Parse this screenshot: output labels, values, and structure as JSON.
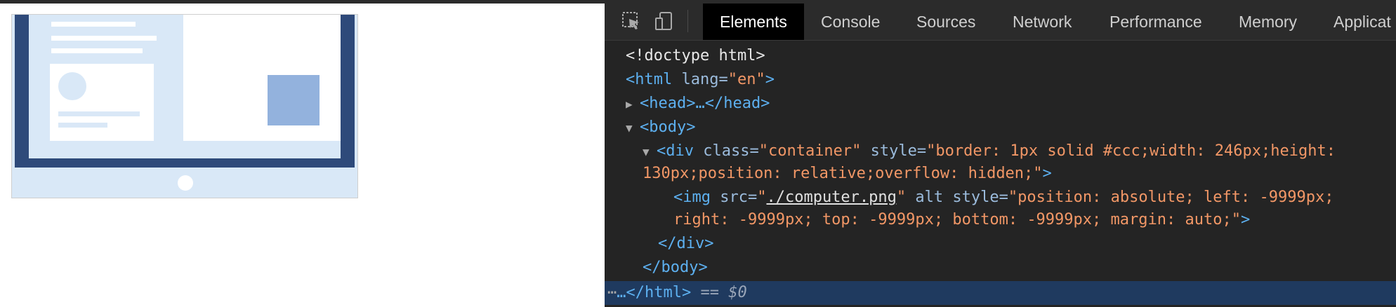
{
  "devtools": {
    "tabs": [
      "Elements",
      "Console",
      "Sources",
      "Network",
      "Performance",
      "Memory",
      "Applicat"
    ],
    "active_tab": "Elements"
  },
  "code": {
    "line1": "<!doctype html>",
    "html_open_tag": "<html",
    "html_lang_attr": "lang=",
    "html_lang_val": "\"en\"",
    "html_close": ">",
    "head": "<head>…</head>",
    "body_open": "<body>",
    "div_open": "<div",
    "div_class_attr": "class=",
    "div_class_val": "\"container\"",
    "div_style_attr": "style=",
    "div_style_val_part1": "\"border: 1px solid #ccc;width: 246px;height:",
    "div_style_val_part2": "130px;position: relative;overflow: hidden;\"",
    "div_tag_end": ">",
    "img_open": "<img",
    "img_src_attr": "src=",
    "img_src_quote_open": "\"",
    "img_src_val": "./computer.png",
    "img_src_quote_close": "\"",
    "img_alt_attr": "alt",
    "img_style_attr": "style=",
    "img_style_val_part1": "\"position: absolute; left: -9999px;",
    "img_style_val_part2": "right: -9999px; top: -9999px; bottom: -9999px; margin: auto;\"",
    "img_tag_end": ">",
    "div_close": "</div>",
    "body_close": "</body>",
    "html_close_line": "…</html>",
    "selected_marker": "== $0"
  },
  "colors": {
    "devtools_bg": "#242424",
    "tag": "#5db0f0",
    "attr_value": "#f29766",
    "selected_row": "#1f3a5f",
    "laptop_dark": "#2e4a7a",
    "laptop_light": "#d9e8f7",
    "laptop_square": "#93b2dd"
  }
}
